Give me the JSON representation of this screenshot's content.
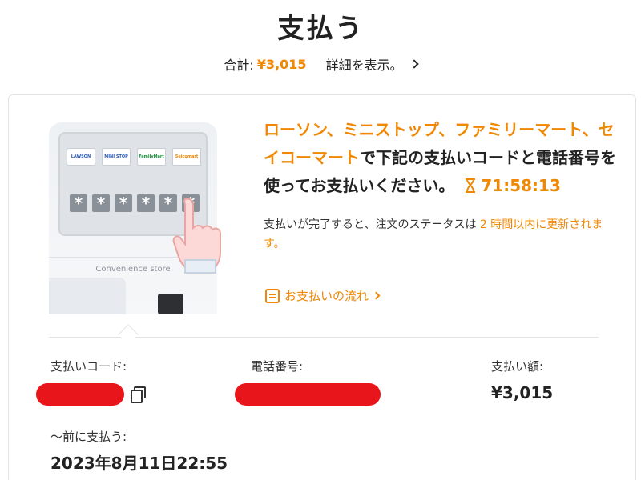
{
  "header": {
    "title": "支払う",
    "total_label": "合計:",
    "total_amount": "¥3,015",
    "details_link": "詳細を表示。"
  },
  "kiosk": {
    "stores": [
      "LAWSON",
      "MINI STOP",
      "FamilyMart",
      "Seicomart"
    ],
    "code_mask": [
      "*",
      "*",
      "*",
      "*",
      "*",
      "*"
    ],
    "label": "Convenience store"
  },
  "instructions": {
    "stores": "ローソン、ミニストップ、ファミリーマート、セイコーマート",
    "text": "で下記の支払いコードと電話番号を使ってお支払いください。",
    "timer": "71:58:13",
    "note_before": "支払いが完了すると、注文のステータスは",
    "note_highlight": "2 時間以内に更新されます。",
    "flow_link": "お支払いの流れ"
  },
  "payment_info": {
    "code_label": "支払いコード:",
    "phone_label": "電話番号:",
    "amount_label": "支払い額:",
    "amount_value": "¥3,015",
    "deadline_label": "〜前に支払う:",
    "deadline_value": "2023年8月11日22:55"
  },
  "colors": {
    "accent": "#f08804",
    "redaction": "#e8161b"
  },
  "icons": {
    "details": "chevron-right-icon",
    "timer": "hourglass-icon",
    "flow": "document-icon",
    "copy": "copy-icon"
  }
}
